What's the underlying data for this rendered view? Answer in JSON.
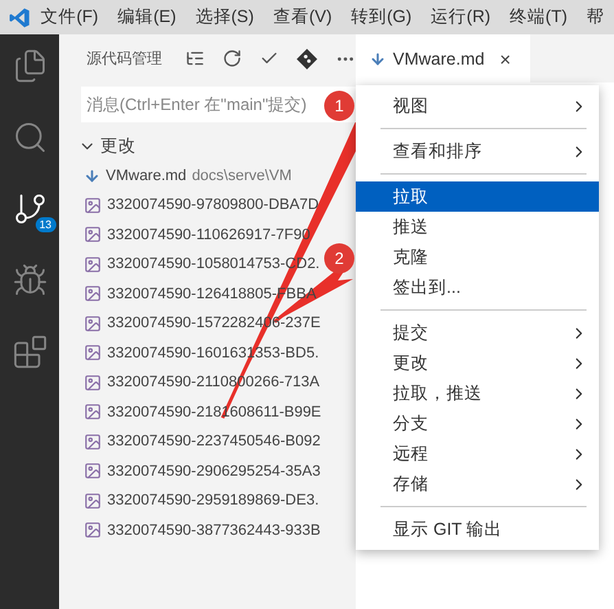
{
  "menubar": {
    "items": [
      "文件(F)",
      "编辑(E)",
      "选择(S)",
      "查看(V)",
      "转到(G)",
      "运行(R)",
      "终端(T)",
      "帮"
    ]
  },
  "activity_bar": {
    "items": [
      {
        "kind": "files",
        "selected": false
      },
      {
        "kind": "search",
        "selected": false
      },
      {
        "kind": "scm",
        "selected": true,
        "badge": "13"
      },
      {
        "kind": "debug",
        "selected": false
      },
      {
        "kind": "extensions",
        "selected": false
      }
    ]
  },
  "source_control": {
    "title": "源代码管理",
    "message": {
      "placeholder": "消息(Ctrl+Enter 在\"main\"提交)"
    },
    "group": {
      "label": "更改",
      "expanded": true
    },
    "files": [
      {
        "kind": "markdown",
        "name": "VMware.md",
        "path": "docs\\serve\\VM"
      },
      {
        "kind": "image",
        "name": "3320074590-97809800-DBA7D"
      },
      {
        "kind": "image",
        "name": "3320074590-110626917-7F90"
      },
      {
        "kind": "image",
        "name": "3320074590-1058014753-CD2."
      },
      {
        "kind": "image",
        "name": "3320074590-126418805-FBBA"
      },
      {
        "kind": "image",
        "name": "3320074590-1572282406-237E"
      },
      {
        "kind": "image",
        "name": "3320074590-1601631353-BD5."
      },
      {
        "kind": "image",
        "name": "3320074590-2110800266-713A"
      },
      {
        "kind": "image",
        "name": "3320074590-2181608611-B99E"
      },
      {
        "kind": "image",
        "name": "3320074590-2237450546-B092"
      },
      {
        "kind": "image",
        "name": "3320074590-2906295254-35A3"
      },
      {
        "kind": "image",
        "name": "3320074590-2959189869-DE3."
      },
      {
        "kind": "image",
        "name": "3320074590-3877362443-933B"
      }
    ]
  },
  "editor_tab": {
    "label": "VMware.md",
    "close": "×"
  },
  "context_menu": {
    "items": [
      {
        "kind": "item",
        "label": "视图",
        "submenu": true,
        "selected": false
      },
      {
        "kind": "separator"
      },
      {
        "kind": "item",
        "label": "查看和排序",
        "submenu": true,
        "selected": false
      },
      {
        "kind": "separator"
      },
      {
        "kind": "item",
        "label": "拉取",
        "submenu": false,
        "selected": true
      },
      {
        "kind": "item",
        "label": "推送",
        "submenu": false,
        "selected": false
      },
      {
        "kind": "item",
        "label": "克隆",
        "submenu": false,
        "selected": false
      },
      {
        "kind": "item",
        "label": "签出到...",
        "submenu": false,
        "selected": false
      },
      {
        "kind": "separator"
      },
      {
        "kind": "item",
        "label": "提交",
        "submenu": true,
        "selected": false
      },
      {
        "kind": "item",
        "label": "更改",
        "submenu": true,
        "selected": false
      },
      {
        "kind": "item",
        "label": "拉取，推送",
        "submenu": true,
        "selected": false
      },
      {
        "kind": "item",
        "label": "分支",
        "submenu": true,
        "selected": false
      },
      {
        "kind": "item",
        "label": "远程",
        "submenu": true,
        "selected": false
      },
      {
        "kind": "item",
        "label": "存储",
        "submenu": true,
        "selected": false
      },
      {
        "kind": "separator"
      },
      {
        "kind": "item",
        "label": "显示 GIT 输出",
        "submenu": false,
        "selected": false
      }
    ]
  },
  "annotations": [
    {
      "label": "1"
    },
    {
      "label": "2"
    }
  ]
}
